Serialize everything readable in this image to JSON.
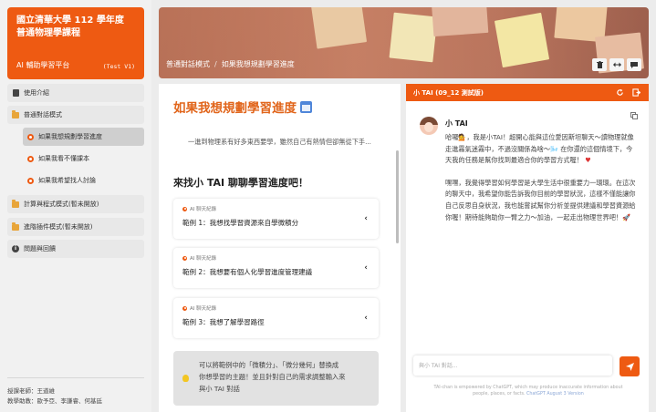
{
  "brand": {
    "title_line1": "國立清華大學 112 學年度",
    "title_line2": "普通物理學課程",
    "platform": "AI 輔助學習平台",
    "version": "(Test V1)",
    "bg_color": "#ee5a12"
  },
  "sidebar": {
    "items": [
      {
        "label": "使用介紹",
        "icon": "book-icon"
      },
      {
        "label": "普通對話模式",
        "icon": "folder-icon"
      },
      {
        "label": "計算與程式模式(暫未開放)",
        "icon": "folder-icon"
      },
      {
        "label": "進階插件模式(暫未開放)",
        "icon": "folder-icon"
      },
      {
        "label": "問題與回饋",
        "icon": "info-icon"
      }
    ],
    "subitems": [
      {
        "label": "如果我想規劃學習進度",
        "active": true
      },
      {
        "label": "如果我看不懂課本",
        "active": false
      },
      {
        "label": "如果我希望找人討論",
        "active": false
      }
    ],
    "footer": {
      "teacher": "授課老師：王道維",
      "assistants": "教學助教：歐予亞、李謙睿、何基廷"
    }
  },
  "header": {
    "breadcrumb": [
      "普通對話模式",
      "如果我想規劃學習進度"
    ],
    "tools": [
      "trash-icon",
      "expand-horizontal-icon",
      "chat-bubble-icon"
    ]
  },
  "content": {
    "title": "如果我想規劃學習進度",
    "title_icon": "calendar-icon",
    "intro": "一進到物理系有好多東西要學，雖然自己有熱情但卻無從下手...",
    "heading": "來找小 TAI 聊聊學習進度吧！",
    "card_tag": "AI 聊天紀錄",
    "examples": [
      "範例 1：我想找學習資源來自學微積分",
      "範例 2：我想要有個人化學習進度管理建議",
      "範例 3：我想了解學習路徑"
    ],
    "tip_line1": "可以將範例中的「微積分」、「微分幾何」替換成",
    "tip_line2": "你想學習的主題！並且針對自己的需求調整輸入來",
    "tip_line3": "與小 TAI 對話"
  },
  "chat": {
    "header_title": "小 TAI (09_12 測試版)",
    "bot_name": "小 TAI",
    "messages": [
      "哈囉💁，我是小TAI！超開心能與這位愛因斯坦聊天～讀物理就像走進霧氣迷霧中，不過沒關係為啥～🌬️ 在你還的這個情境下，今天我的任務是幫你找到最適合你的學習方式喔！",
      "嘿嘿，我覺得學習如何學習是大學生活中很重要力一環環。在這次的聊天中，我希望你能告訴我你目前的學習狀況，這樣不僅能讓你自己反思自身狀況，我也能嘗試幫你分析並提供建議和學習資源給你喔！期待能夠助你一臂之力～加油，一起走出物理世界吧！🚀"
    ],
    "heart": "♥",
    "input_placeholder": "與小 TAI 對話...",
    "disclaimer_line1": "TAI-chan is empowered by ChatGPT, which may produce inaccurate information about",
    "disclaimer_line2": "people, places, or facts.",
    "disclaimer_link": "ChatGPT August 3 Version",
    "accent_color": "#ee5a12"
  }
}
